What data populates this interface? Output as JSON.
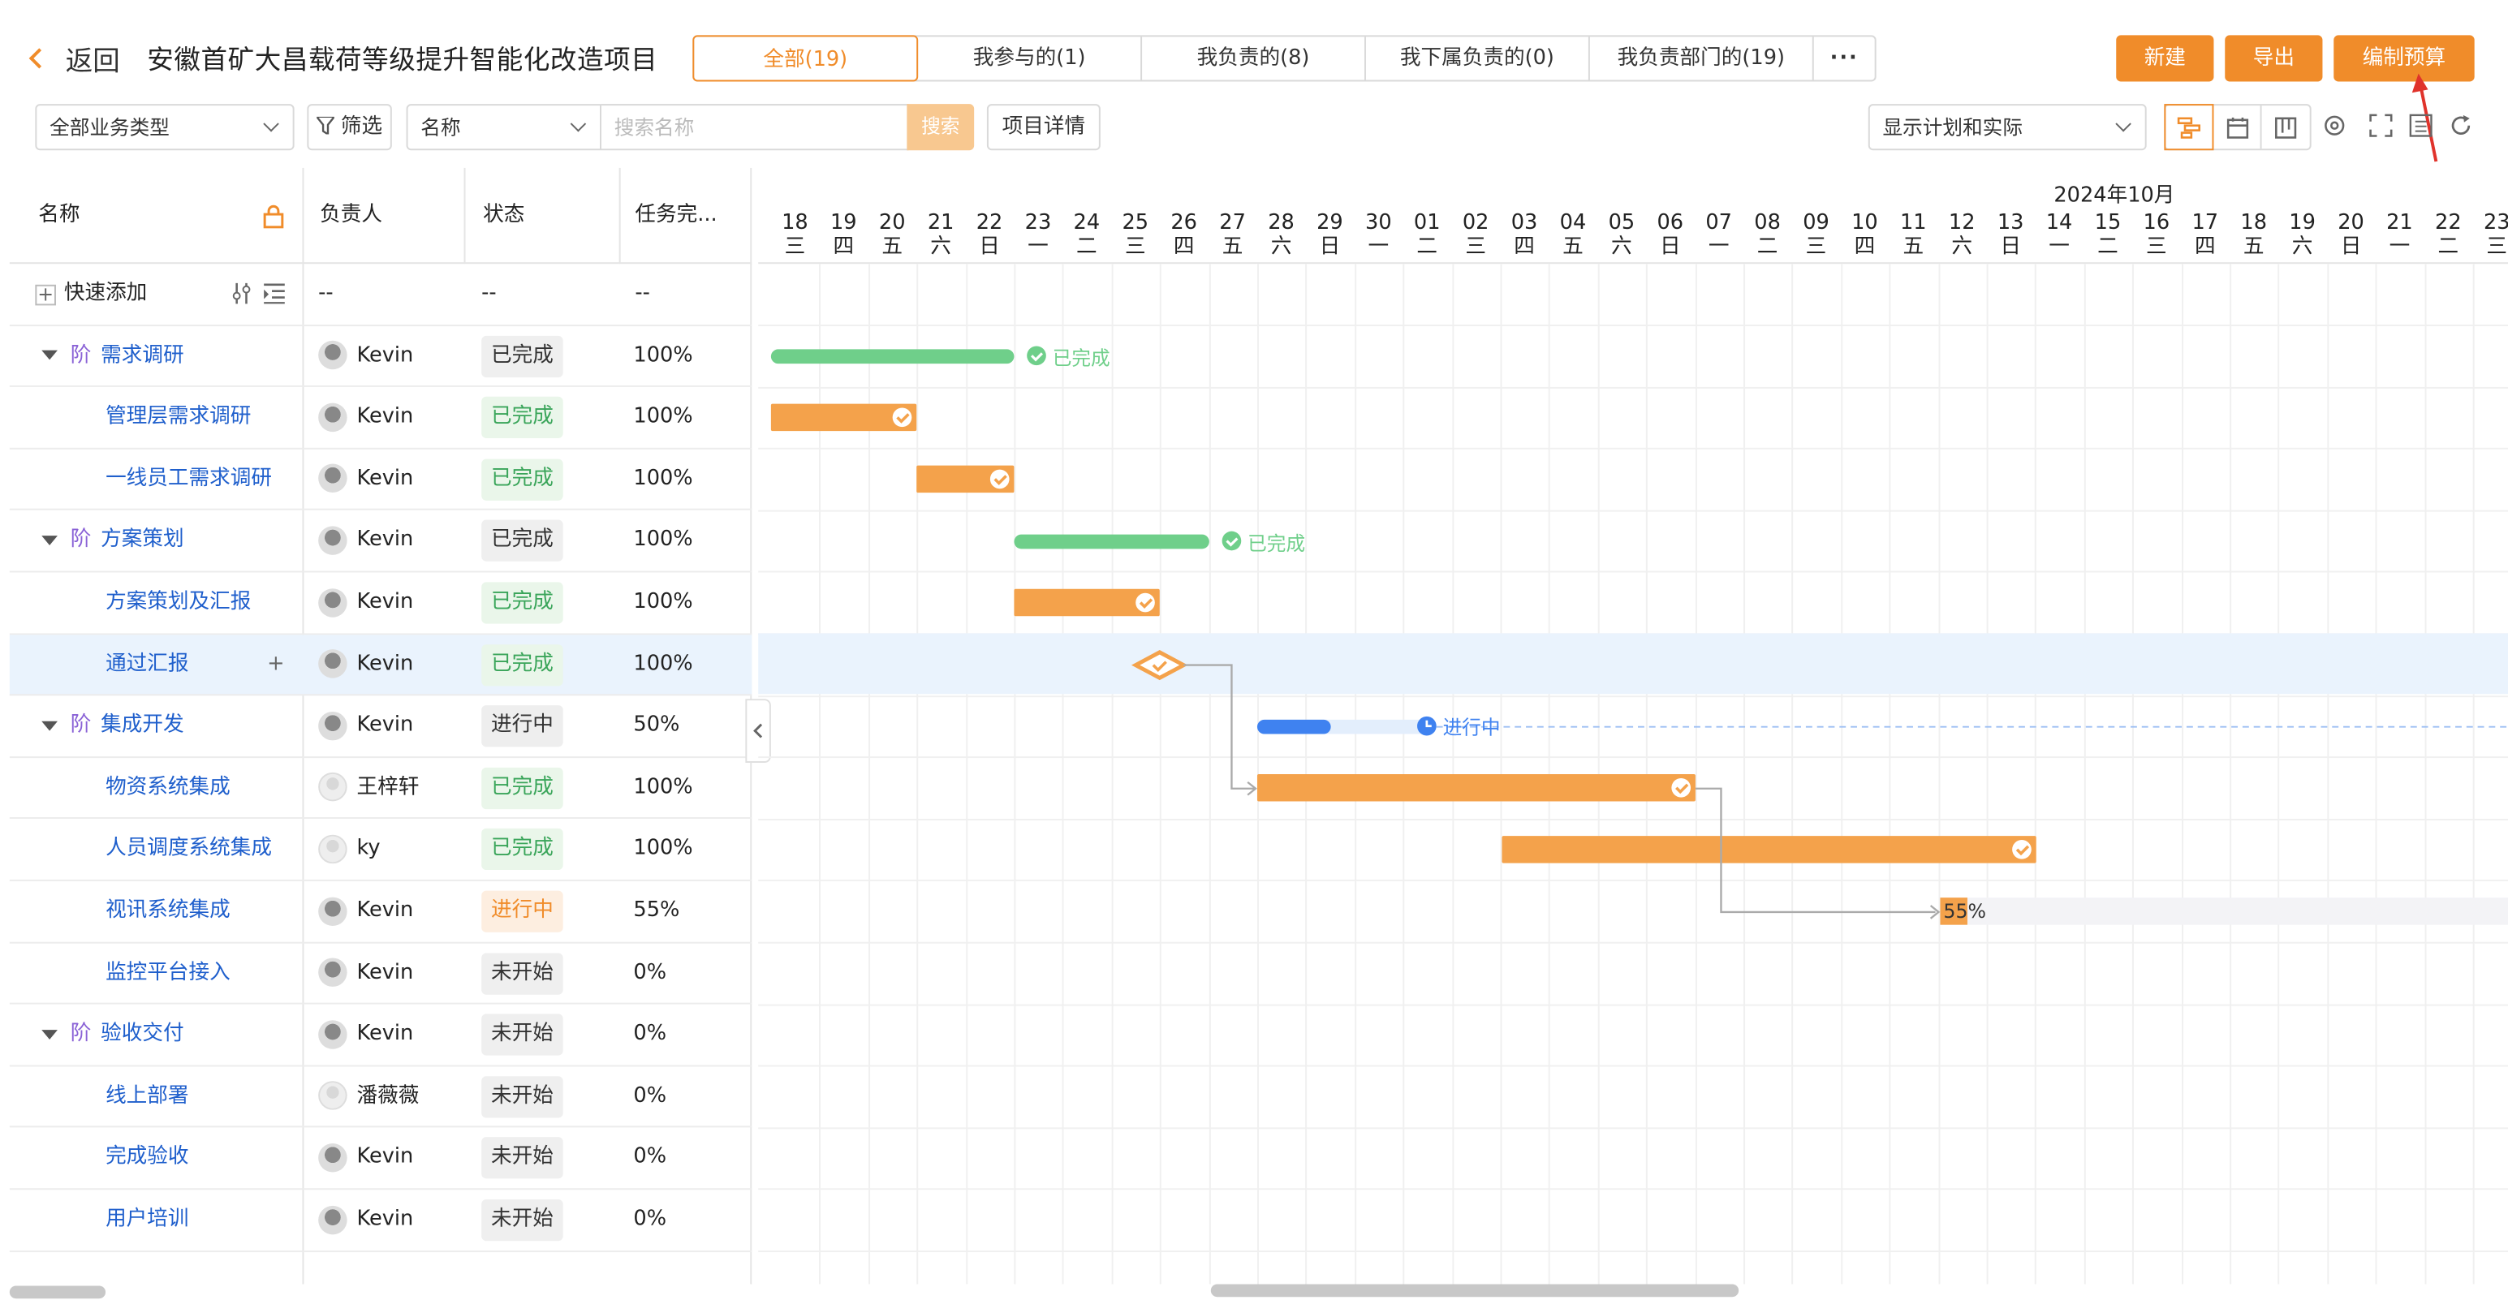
{
  "header": {
    "back_label": "返回",
    "title": "安徽首矿大昌载荷等级提升智能化改造项目",
    "tabs": [
      {
        "label": "全部(19)",
        "active": true
      },
      {
        "label": "我参与的(1)"
      },
      {
        "label": "我负责的(8)"
      },
      {
        "label": "我下属负责的(0)"
      },
      {
        "label": "我负责部门的(19)"
      },
      {
        "label": "···"
      }
    ],
    "buttons": {
      "new": "新建",
      "export": "导出",
      "budget": "编制预算"
    }
  },
  "toolbar": {
    "biz_type": "全部业务类型",
    "filter": "筛选",
    "field": "名称",
    "search_placeholder": "搜索名称",
    "search_btn": "搜索",
    "project_detail": "项目详情",
    "plan_mode": "显示计划和实际"
  },
  "table": {
    "columns": {
      "name": "名称",
      "owner": "负责人",
      "status": "状态",
      "progress": "任务完..."
    },
    "quick_add": {
      "label": "快速添加",
      "owner": "--",
      "status": "--",
      "progress": "--"
    },
    "stage_tag": "阶",
    "rows": [
      {
        "name": "需求调研",
        "stage": true,
        "owner": "Kevin",
        "status": "已完成",
        "progress": "100%"
      },
      {
        "name": "管理层需求调研",
        "owner": "Kevin",
        "status": "已完成",
        "progress": "100%"
      },
      {
        "name": "一线员工需求调研",
        "owner": "Kevin",
        "status": "已完成",
        "progress": "100%"
      },
      {
        "name": "方案策划",
        "stage": true,
        "owner": "Kevin",
        "status": "已完成",
        "progress": "100%"
      },
      {
        "name": "方案策划及汇报",
        "owner": "Kevin",
        "status": "已完成",
        "progress": "100%"
      },
      {
        "name": "通过汇报",
        "owner": "Kevin",
        "status": "已完成",
        "progress": "100%",
        "highlight": true,
        "add": "+"
      },
      {
        "name": "集成开发",
        "stage": true,
        "owner": "Kevin",
        "status": "进行中",
        "progress": "50%"
      },
      {
        "name": "物资系统集成",
        "owner": "王梓轩",
        "status": "已完成",
        "progress": "100%"
      },
      {
        "name": "人员调度系统集成",
        "owner": "ky",
        "status": "已完成",
        "progress": "100%"
      },
      {
        "name": "视讯系统集成",
        "owner": "Kevin",
        "status": "进行中",
        "progress": "55%"
      },
      {
        "name": "监控平台接入",
        "owner": "Kevin",
        "status": "未开始",
        "progress": "0%"
      },
      {
        "name": "验收交付",
        "stage": true,
        "owner": "Kevin",
        "status": "未开始",
        "progress": "0%"
      },
      {
        "name": "线上部署",
        "owner": "潘薇薇",
        "status": "未开始",
        "progress": "0%"
      },
      {
        "name": "完成验收",
        "owner": "Kevin",
        "status": "未开始",
        "progress": "0%"
      },
      {
        "name": "用户培训",
        "owner": "Kevin",
        "status": "未开始",
        "progress": "0%"
      }
    ]
  },
  "gantt": {
    "month": "2024年10月",
    "days": [
      {
        "d": "18",
        "w": "三"
      },
      {
        "d": "19",
        "w": "四"
      },
      {
        "d": "20",
        "w": "五"
      },
      {
        "d": "21",
        "w": "六"
      },
      {
        "d": "22",
        "w": "日"
      },
      {
        "d": "23",
        "w": "一"
      },
      {
        "d": "24",
        "w": "二"
      },
      {
        "d": "25",
        "w": "三"
      },
      {
        "d": "26",
        "w": "四"
      },
      {
        "d": "27",
        "w": "五"
      },
      {
        "d": "28",
        "w": "六"
      },
      {
        "d": "29",
        "w": "日"
      },
      {
        "d": "30",
        "w": "一"
      },
      {
        "d": "01",
        "w": "二"
      },
      {
        "d": "02",
        "w": "三"
      },
      {
        "d": "03",
        "w": "四"
      },
      {
        "d": "04",
        "w": "五"
      },
      {
        "d": "05",
        "w": "六"
      },
      {
        "d": "06",
        "w": "日"
      },
      {
        "d": "07",
        "w": "一"
      },
      {
        "d": "08",
        "w": "二"
      },
      {
        "d": "09",
        "w": "三"
      },
      {
        "d": "10",
        "w": "四"
      },
      {
        "d": "11",
        "w": "五"
      },
      {
        "d": "12",
        "w": "六"
      },
      {
        "d": "13",
        "w": "日"
      },
      {
        "d": "14",
        "w": "一"
      },
      {
        "d": "15",
        "w": "二"
      },
      {
        "d": "16",
        "w": "三"
      },
      {
        "d": "17",
        "w": "四"
      },
      {
        "d": "18",
        "w": "五"
      },
      {
        "d": "19",
        "w": "六"
      },
      {
        "d": "20",
        "w": "日"
      },
      {
        "d": "21",
        "w": "一"
      },
      {
        "d": "22",
        "w": "二"
      },
      {
        "d": "23",
        "w": "三"
      }
    ],
    "labels": {
      "done": "已完成",
      "inprogress": "进行中",
      "pct55": "55%"
    },
    "colors": {
      "task": "#f4a24b",
      "stage_done": "#6fcf8a",
      "stage_progress": "#3f82f0",
      "accent": "#f08c2a"
    }
  }
}
